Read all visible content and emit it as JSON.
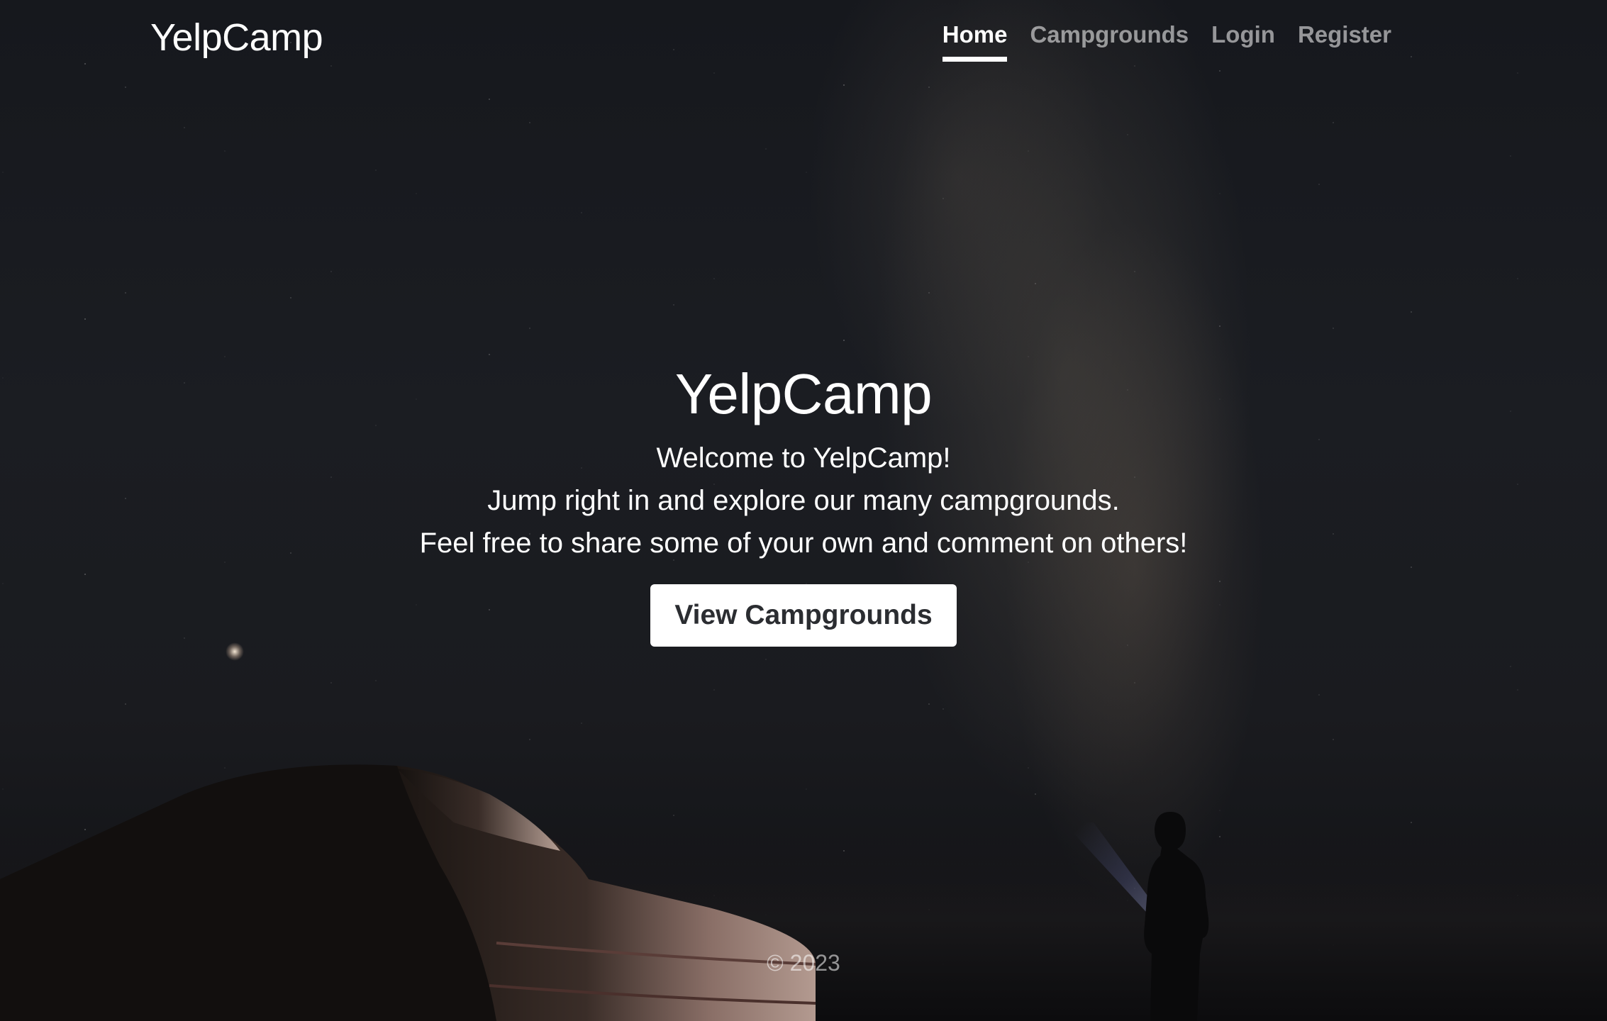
{
  "nav": {
    "brand": "YelpCamp",
    "links": [
      {
        "label": "Home",
        "active": true
      },
      {
        "label": "Campgrounds",
        "active": false
      },
      {
        "label": "Login",
        "active": false
      },
      {
        "label": "Register",
        "active": false
      }
    ]
  },
  "hero": {
    "title": "YelpCamp",
    "lines": [
      "Welcome to YelpCamp!",
      "Jump right in and explore our many campgrounds.",
      "Feel free to share some of your own and comment on others!"
    ],
    "cta_label": "View Campgrounds"
  },
  "footer": {
    "copyright": "© 2023"
  },
  "colors": {
    "accent_text": "#ffffff",
    "muted_link": "#8c8c8c",
    "button_bg": "#ffffff",
    "button_text": "#2b2d31"
  }
}
